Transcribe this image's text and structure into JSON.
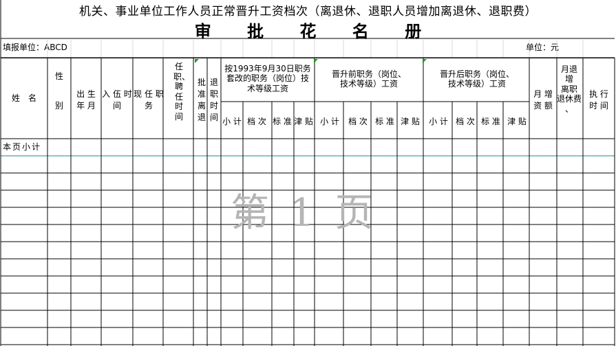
{
  "title_line1": "机关、事业单位工作人员正常晋升工资档次（离退休、退职人员增加离退休、退职费）",
  "title_line2": "审 批 花 名 册",
  "unit_label": "填报单位：ABCD",
  "currency_label": "单位：元",
  "headers": {
    "name": "姓　名",
    "gender": "性\n\n\n别",
    "birth": "出\n生\n年\n月",
    "enlist": "入\n伍\n时\n间",
    "current_post": "现\n任\n职\n务",
    "appoint": "任职、聘任时间",
    "approve": "批\n准\n离\n退",
    "retire_time": "退\n职\n时\n间",
    "group1": "按1993年9月30日职务\n套改的职务（岗位）技\n术等级工资",
    "group2": "晋升前职务（岗位、\n技术等级）工资",
    "group3": "晋升后职务（岗位、\n技术等级）工资",
    "sub_subtotal": "小\n\n计",
    "sub_grade": "档\n\n次",
    "sub_standard": "标\n\n准",
    "sub_allowance": "津\n\n贴",
    "monthly_increase": "月\n增\n资\n额",
    "monthly_retire_increase": "月退\n增\n离职\n退休费\n、",
    "exec_time": "执\n行\n时\n间"
  },
  "subtotal_row_label": "本页小计",
  "watermark": "第 1 页",
  "empty_rows": 11
}
